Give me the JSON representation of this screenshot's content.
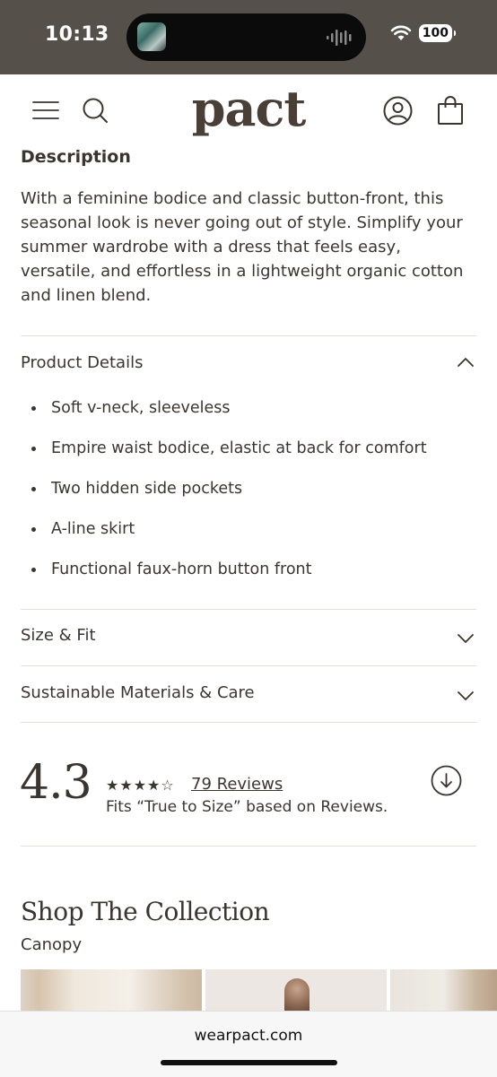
{
  "status_bar": {
    "time": "10:13",
    "battery": "100",
    "icons": [
      "wifi-icon",
      "battery-icon",
      "audio-wave-icon"
    ]
  },
  "header": {
    "logo": "pact",
    "icons": [
      "menu-icon",
      "search-icon",
      "account-icon",
      "cart-icon"
    ]
  },
  "description": {
    "title": "Description",
    "body": "With a feminine bodice and classic button-front, this seasonal look is never going out of style. Simplify your summer wardrobe with a dress that feels easy, versatile, and effortless in a lightweight organic cotton and linen blend."
  },
  "product_details": {
    "title": "Product Details",
    "expanded": true,
    "items": [
      "Soft v-neck, sleeveless",
      "Empire waist bodice, elastic at back for comfort",
      "Two hidden side pockets",
      "A-line skirt",
      "Functional faux-horn button front"
    ]
  },
  "size_fit": {
    "title": "Size & Fit",
    "expanded": false
  },
  "materials": {
    "title": "Sustainable Materials & Care",
    "expanded": false
  },
  "reviews": {
    "rating": "4.3",
    "stars": "★★★★☆",
    "star_value": 4.3,
    "count_label": "79 Reviews",
    "fit_text": "Fits “True to Size” based on Reviews."
  },
  "collection": {
    "title": "Shop The Collection",
    "subtitle": "Canopy"
  },
  "browser": {
    "url": "wearpact.com"
  },
  "colors": {
    "status_bar_bg": "#55514a",
    "text": "#3b3530",
    "divider": "#e2dfdb"
  }
}
